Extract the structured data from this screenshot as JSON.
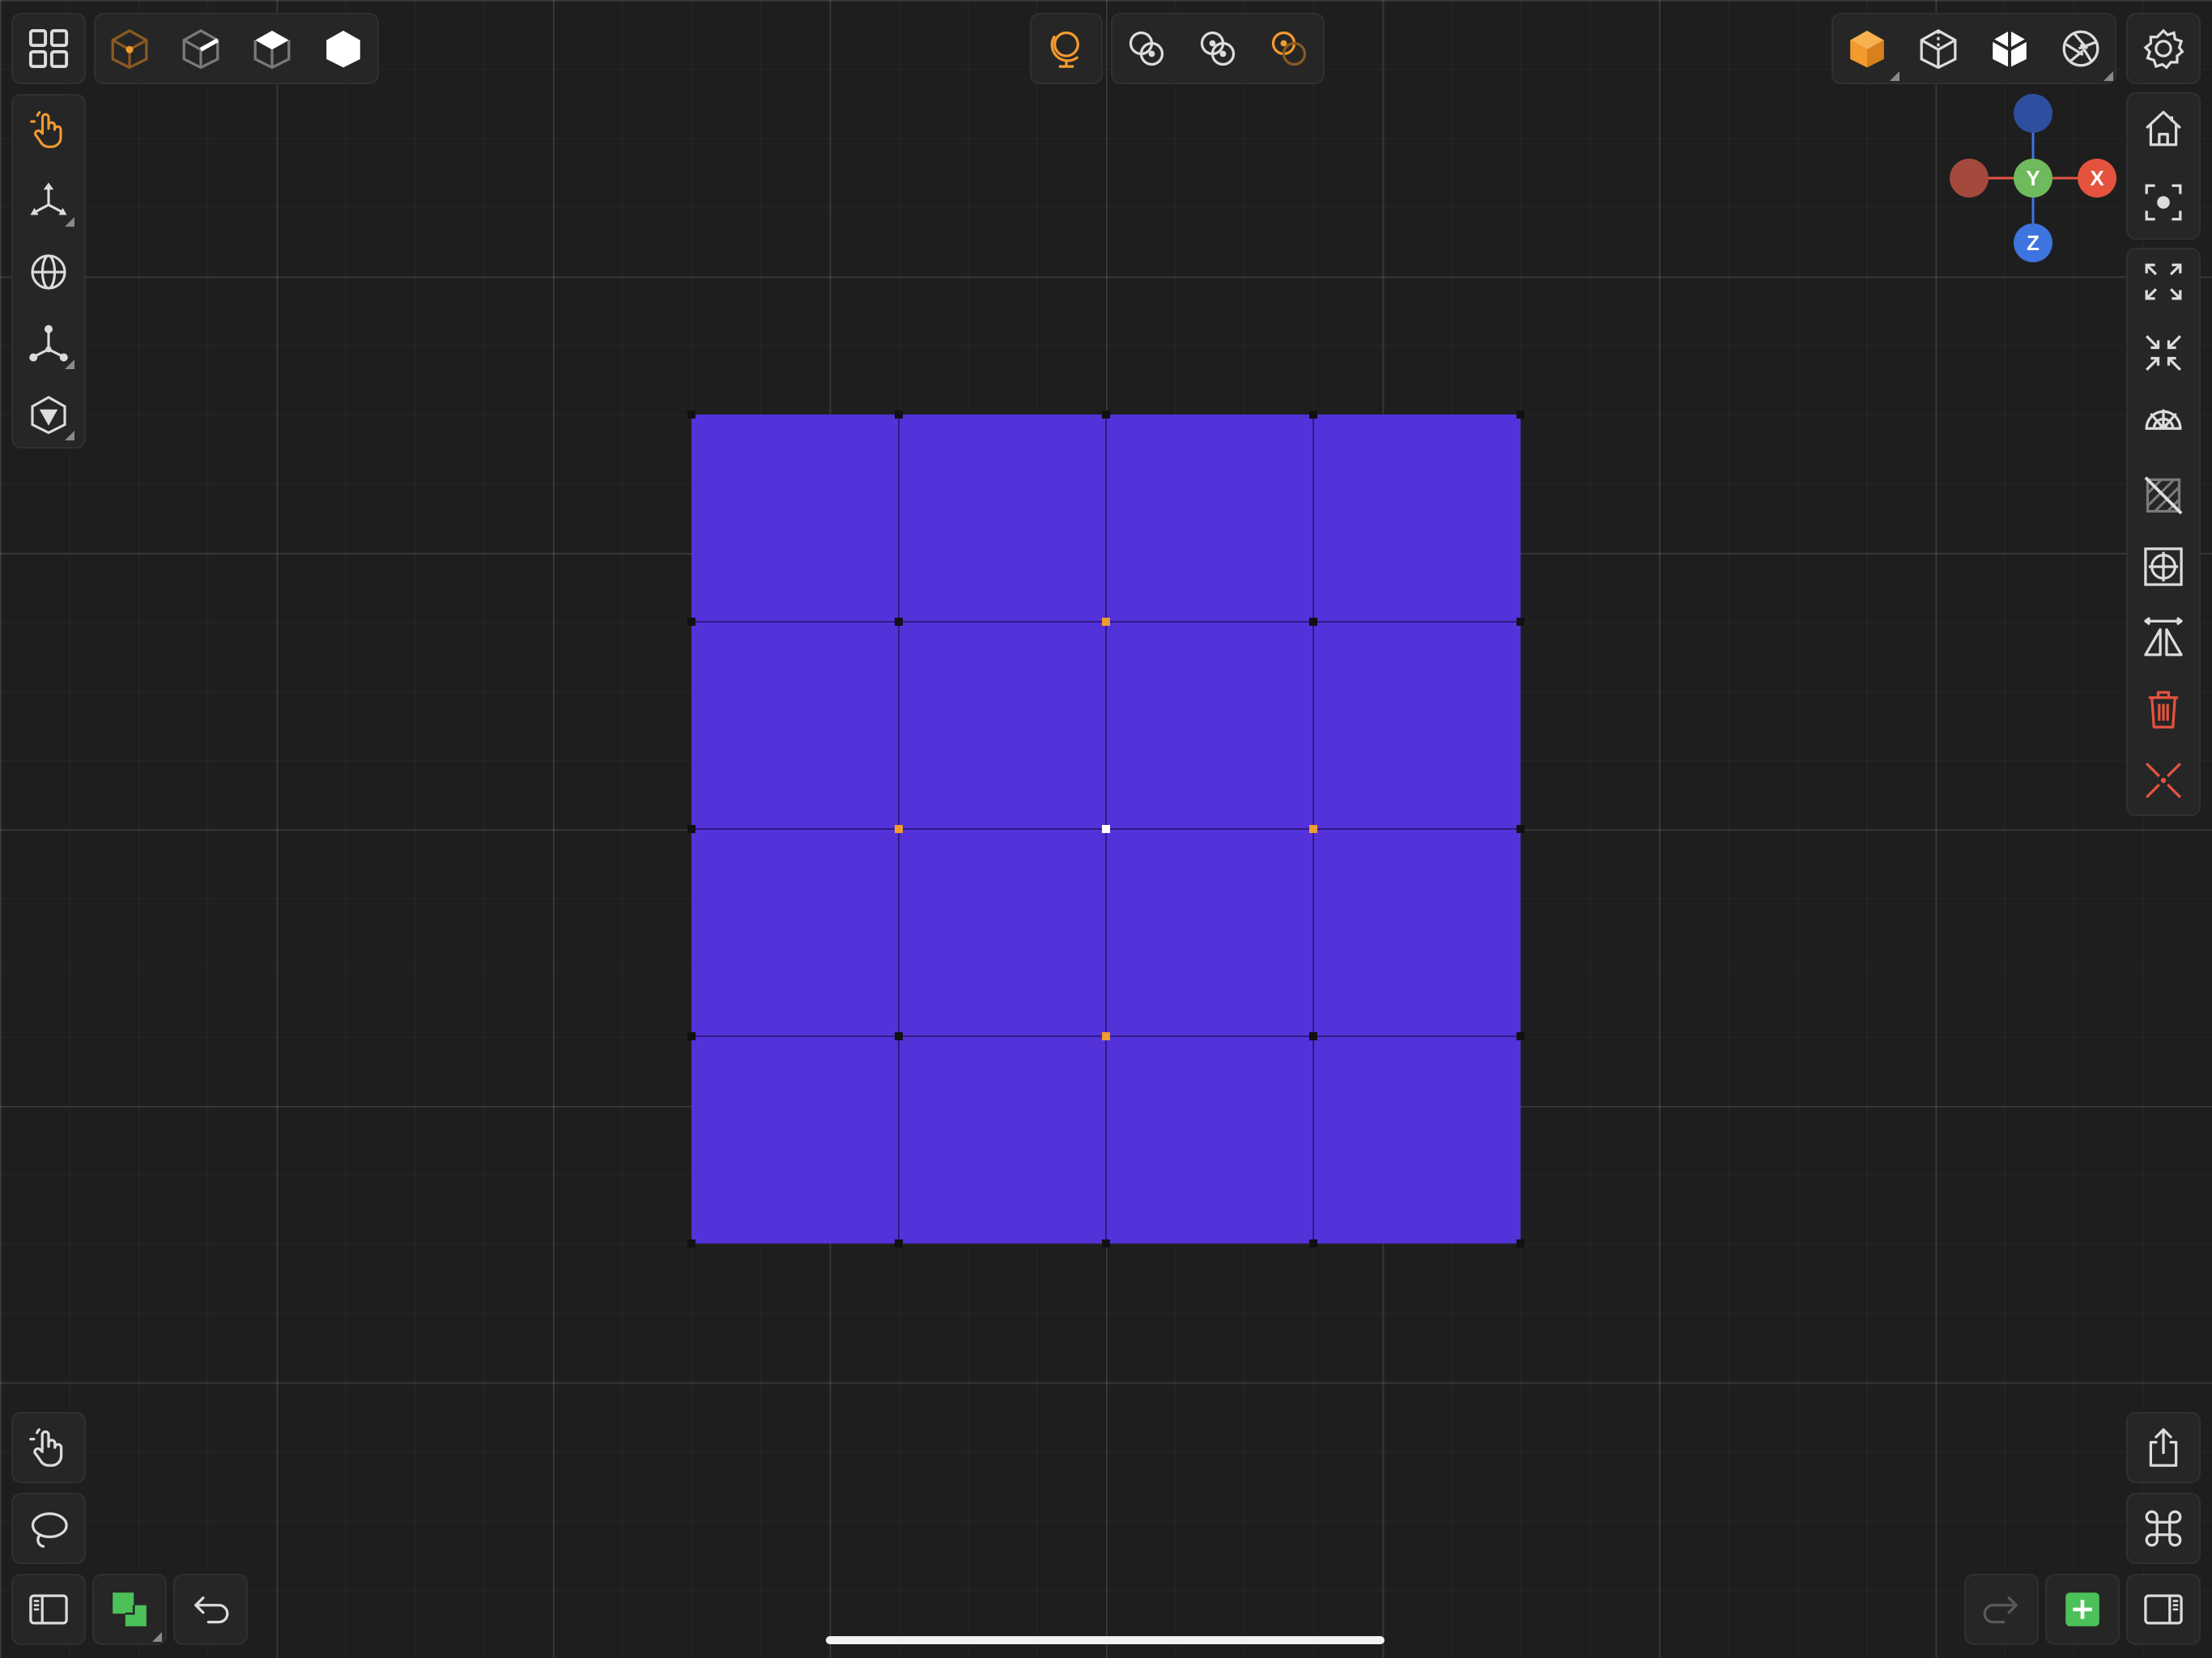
{
  "colors": {
    "background": "#1e1e1e",
    "panel": "#262626",
    "accent_orange": "#f29a2e",
    "icon_light": "#dcdcdc",
    "mesh_fill": "#5332d9",
    "delete_red": "#e5533f",
    "add_green": "#4cc15a",
    "axis_x": "#e5533f",
    "axis_y": "#6fba5c",
    "axis_z": "#3e74e0",
    "selected_vertex": "#f29a2e",
    "active_vertex": "#ffffff"
  },
  "top_left_toolbar": {
    "menu_icon": "grid-menu-icon",
    "selection_modes": [
      "vertex-mode-icon",
      "edge-mode-icon",
      "face-mode-icon",
      "object-mode-icon"
    ]
  },
  "top_center_toolbar": {
    "pivot_icon": "pivot-globe-icon",
    "snap_modes": [
      "snap-circles-icon",
      "snap-dots-icon",
      "snap-orange-icon"
    ]
  },
  "top_right_toolbar": {
    "shading_modes": [
      "solid-shading-icon",
      "wireframe-shading-icon",
      "xray-shading-icon",
      "render-shading-icon"
    ],
    "settings_icon": "settings-icon"
  },
  "left_tools": [
    "select-tool-icon",
    "move-tool-icon",
    "rotate-tool-icon",
    "scale-tool-icon",
    "inset-tool-icon"
  ],
  "right_tools": [
    "home-view-icon",
    "focus-icon",
    "expand-icon",
    "collapse-icon",
    "subdivide-icon",
    "hide-icon",
    "origin-icon",
    "mirror-icon",
    "delete-icon",
    "dissolve-icon"
  ],
  "gizmo": {
    "x_label": "X",
    "y_label": "Y",
    "z_label": "Z"
  },
  "bottom_left": [
    "gesture-icon",
    "lasso-icon",
    "sidebar-left-icon",
    "layers-icon",
    "undo-icon"
  ],
  "bottom_right": [
    "share-icon",
    "command-icon",
    "redo-icon",
    "add-icon",
    "sidebar-right-icon"
  ],
  "mesh": {
    "grid_divisions": 4,
    "selected_vertices": [
      "2,1",
      "1,2",
      "3,2",
      "2,3"
    ],
    "active_vertex": "2,2"
  }
}
